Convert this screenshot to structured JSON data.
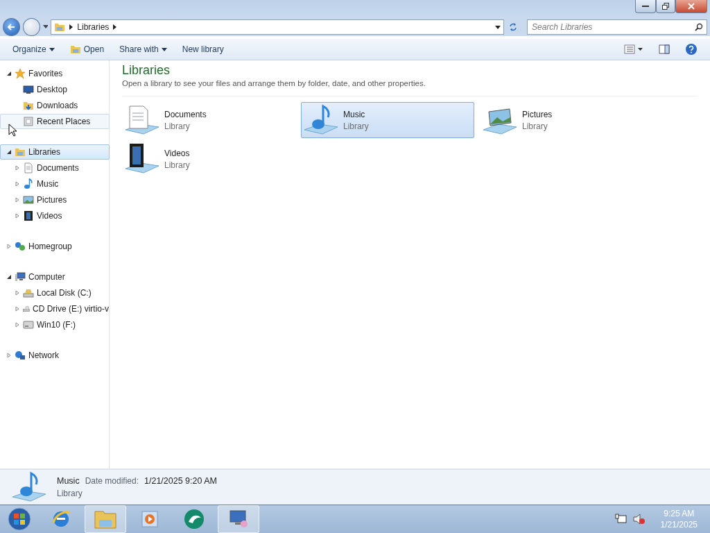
{
  "address_bar": {
    "crumbs": [
      "Libraries"
    ],
    "search_placeholder": "Search Libraries"
  },
  "toolbar": {
    "buttons": [
      {
        "label": "Organize",
        "kind": "menu"
      },
      {
        "label": "Open",
        "kind": "open"
      },
      {
        "label": "Share with",
        "kind": "menu"
      },
      {
        "label": "New library",
        "kind": "plain"
      }
    ]
  },
  "navigation": [
    {
      "label": "Favorites",
      "kind": "star",
      "expanded": true,
      "selected": false,
      "hovered": false,
      "children": [
        {
          "label": "Desktop",
          "kind": "desktop",
          "selected": false,
          "hovered": false
        },
        {
          "label": "Downloads",
          "kind": "downloads",
          "selected": false,
          "hovered": false
        },
        {
          "label": "Recent Places",
          "kind": "recent",
          "selected": false,
          "hovered": true
        }
      ]
    },
    {
      "label": "Libraries",
      "kind": "library",
      "expanded": true,
      "selected": true,
      "hovered": false,
      "children": [
        {
          "label": "Documents",
          "kind": "document",
          "expanded": false,
          "selected": false,
          "hovered": false
        },
        {
          "label": "Music",
          "kind": "music",
          "expanded": false,
          "selected": false,
          "hovered": false
        },
        {
          "label": "Pictures",
          "kind": "pictures",
          "expanded": false,
          "selected": false,
          "hovered": false
        },
        {
          "label": "Videos",
          "kind": "videos",
          "expanded": false,
          "selected": false,
          "hovered": false
        }
      ]
    },
    {
      "label": "Homegroup",
      "kind": "homegroup",
      "expanded": false,
      "selected": false,
      "hovered": false
    },
    {
      "label": "Computer",
      "kind": "computer",
      "expanded": true,
      "selected": false,
      "hovered": false,
      "children": [
        {
          "label": "Local Disk (C:)",
          "kind": "disk",
          "expanded": false,
          "selected": false,
          "hovered": false
        },
        {
          "label": "CD Drive (E:) virtio-v",
          "kind": "cd",
          "expanded": false,
          "selected": false,
          "hovered": false
        },
        {
          "label": "Win10 (F:)",
          "kind": "drive",
          "expanded": false,
          "selected": false,
          "hovered": false
        }
      ]
    },
    {
      "label": "Network",
      "kind": "network",
      "expanded": false,
      "selected": false,
      "hovered": false
    }
  ],
  "content": {
    "title": "Libraries",
    "description": "Open a library to see your files and arrange them by folder, date, and other properties.",
    "libraries": [
      {
        "name": "Documents",
        "type": "Library",
        "kind": "document",
        "selected": false
      },
      {
        "name": "Music",
        "type": "Library",
        "kind": "music",
        "selected": true
      },
      {
        "name": "Pictures",
        "type": "Library",
        "kind": "pictures",
        "selected": false
      },
      {
        "name": "Videos",
        "type": "Library",
        "kind": "videos",
        "selected": false
      }
    ]
  },
  "details": {
    "name": "Music",
    "field_label": "Date modified:",
    "field_value": "1/21/2025 9:20 AM",
    "type": "Library"
  },
  "taskbar": {
    "apps": [
      {
        "kind": "browser",
        "active": false
      },
      {
        "kind": "explorer",
        "active": true
      },
      {
        "kind": "media",
        "active": false
      },
      {
        "kind": "green",
        "active": false
      },
      {
        "kind": "remote",
        "active": true
      }
    ],
    "time": "9:25 AM",
    "date": "1/21/2025"
  }
}
